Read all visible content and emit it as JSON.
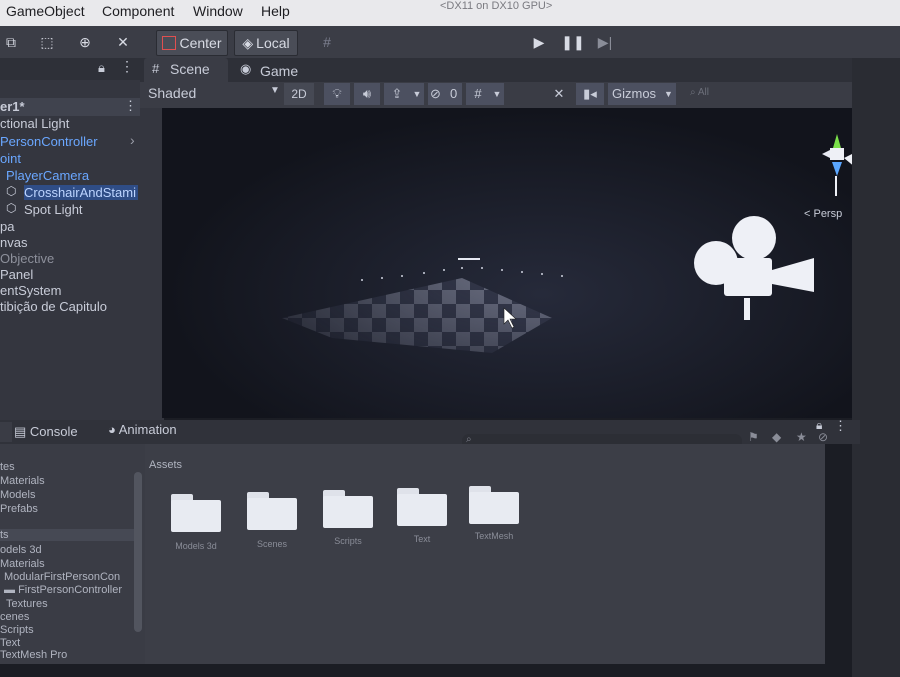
{
  "menu": {
    "items": [
      "GameObject",
      "Component",
      "Window",
      "Help"
    ],
    "title_fragment": "<DX11 on DX10 GPU>"
  },
  "toolbar": {
    "pivot_label": "Center",
    "space_label": "Local",
    "play_icon": "play-icon",
    "pause_icon": "pause-icon",
    "step_icon": "step-icon"
  },
  "hierarchy": {
    "scene_name": "er1*",
    "items": [
      {
        "label": "ctional Light",
        "style": "normal"
      },
      {
        "label": "PersonController",
        "style": "blue"
      },
      {
        "label": "oint",
        "style": "blue"
      },
      {
        "label": "PlayerCamera",
        "style": "blue"
      },
      {
        "label": "CrosshairAndStami",
        "style": "blue"
      },
      {
        "label": "Spot Light",
        "style": "normal"
      },
      {
        "label": "pa",
        "style": "normal"
      },
      {
        "label": "nvas",
        "style": "normal"
      },
      {
        "label": "Objective",
        "style": "grey"
      },
      {
        "label": "Panel",
        "style": "normal"
      },
      {
        "label": "entSystem",
        "style": "normal"
      },
      {
        "label": "tibição de Capitulo",
        "style": "normal"
      }
    ]
  },
  "scene_view": {
    "tabs": [
      {
        "label": "Scene",
        "active": true
      },
      {
        "label": "Game",
        "active": false
      }
    ],
    "shading_mode": "Shaded",
    "mode_2d": "2D",
    "hidden_count": "0",
    "gizmos_label": "Gizmos",
    "search_placeholder": "All",
    "projection_label": "< Persp"
  },
  "bottom": {
    "tabs": [
      "Console",
      "Animation"
    ],
    "assets_header": "Assets",
    "folders": [
      "Models 3d",
      "Scenes",
      "Scripts",
      "Text",
      "TextMesh"
    ],
    "project_tree": [
      "tes",
      "Materials",
      "Models",
      "Prefabs",
      "ts",
      "odels 3d",
      "Materials",
      "ModularFirstPersonCon",
      "FirstPersonController",
      "Textures",
      "cenes",
      "Scripts",
      "Text",
      "TextMesh Pro"
    ]
  },
  "colors": {
    "menubar": "#e9e9ec",
    "toolbar": "#3b3d46",
    "panel": "#34363f",
    "accent_blue": "#6aa7ff"
  }
}
